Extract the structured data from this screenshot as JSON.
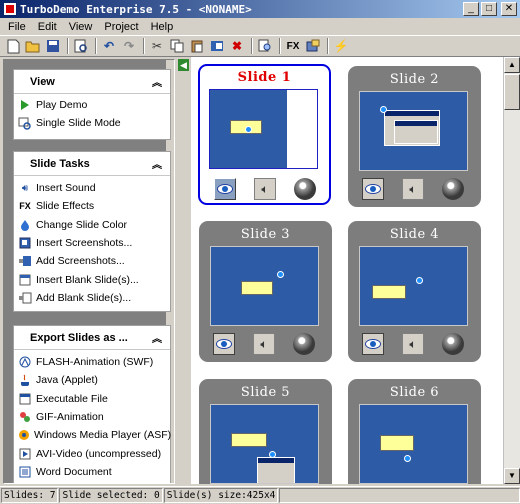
{
  "window": {
    "title": "TurboDemo Enterprise 7.5 - <NONAME>"
  },
  "menu": [
    "File",
    "Edit",
    "View",
    "Project",
    "Help"
  ],
  "toolbar": {
    "buttons": [
      "new-icon",
      "open-icon",
      "save-icon",
      "preview-icon",
      "undo-icon",
      "redo-icon",
      "cut-icon",
      "copy-icon",
      "paste-icon",
      "insert-slide-icon",
      "delete-icon",
      "find-icon",
      "effects-icon",
      "properties-icon",
      "wizard-icon"
    ],
    "fx_label": "FX"
  },
  "view_group": {
    "title": "View",
    "items": [
      {
        "label": "Play Demo",
        "icon": "play-icon"
      },
      {
        "label": "Single Slide Mode",
        "icon": "single-slide-icon"
      }
    ]
  },
  "tasks_group": {
    "title": "Slide Tasks",
    "items": [
      {
        "label": "Insert Sound",
        "icon": "sound-icon"
      },
      {
        "label": "Slide Effects",
        "icon": "fx-icon"
      },
      {
        "label": "Change Slide Color",
        "icon": "color-icon"
      },
      {
        "label": "Insert Screenshots...",
        "icon": "screenshot-icon"
      },
      {
        "label": "Add Screenshots...",
        "icon": "add-screenshot-icon"
      },
      {
        "label": "Insert Blank Slide(s)...",
        "icon": "blank-slide-icon"
      },
      {
        "label": "Add Blank Slide(s)...",
        "icon": "add-blank-slide-icon"
      }
    ]
  },
  "export_group": {
    "title": "Export Slides as ...",
    "items": [
      {
        "label": "FLASH-Animation (SWF)",
        "icon": "flash-icon"
      },
      {
        "label": "Java (Applet)",
        "icon": "java-icon"
      },
      {
        "label": "Executable File",
        "icon": "exe-icon"
      },
      {
        "label": "GIF-Animation",
        "icon": "gif-icon"
      },
      {
        "label": "Windows Media Player (ASF)",
        "icon": "wmp-icon"
      },
      {
        "label": "AVI-Video (uncompressed)",
        "icon": "avi-icon"
      },
      {
        "label": "Word Document",
        "icon": "word-icon"
      }
    ]
  },
  "slides": [
    {
      "title": "Slide 1",
      "selected": true
    },
    {
      "title": "Slide 2",
      "selected": false
    },
    {
      "title": "Slide 3",
      "selected": false
    },
    {
      "title": "Slide 4",
      "selected": false
    },
    {
      "title": "Slide 5",
      "selected": false
    },
    {
      "title": "Slide 6",
      "selected": false
    }
  ],
  "status": {
    "slides": "Slides: 7",
    "selected": "Slide selected: 0",
    "size": "Slide(s) size:425x4"
  }
}
